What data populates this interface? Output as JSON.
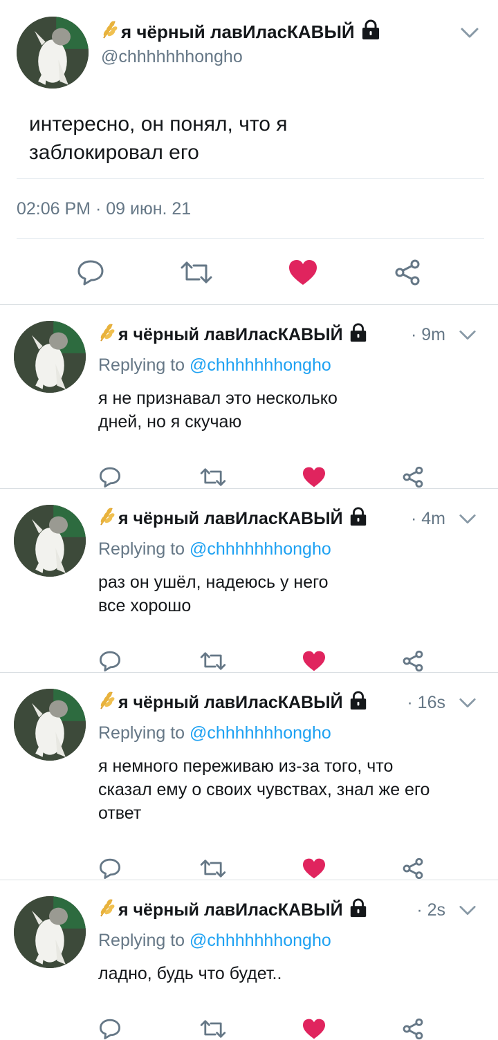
{
  "main_tweet": {
    "display_name": "я чёрный лавИласКАВЫЙ",
    "handle": "@chhhhhhhongho",
    "text": "интересно, он понял, что я\nзаблокировал его",
    "timestamp": "02:06 PM · 09 июн. 21",
    "icons": {
      "name_emoji": "wheat-emoji-icon",
      "protected": "lock-icon",
      "menu": "chevron-down-icon",
      "reply": "reply-icon",
      "retweet": "retweet-icon",
      "like": "heart-icon",
      "share": "share-icon"
    }
  },
  "replies": [
    {
      "display_name": "я чёрный лавИласКАВЫЙ",
      "time": "· 9m",
      "replying_prefix": "Replying to",
      "replying_to": "@chhhhhhhongho",
      "text": "я не признавал это несколько\nдней, но я скучаю"
    },
    {
      "display_name": "я чёрный лавИласКАВЫЙ",
      "time": "· 4m",
      "replying_prefix": "Replying to",
      "replying_to": "@chhhhhhhongho",
      "text": "раз он ушёл, надеюсь у него\nвсе хорошо"
    },
    {
      "display_name": "я чёрный лавИласКАВЫЙ",
      "time": "· 16s",
      "replying_prefix": "Replying to",
      "replying_to": "@chhhhhhhongho",
      "text": "я немного переживаю из-за того, что\nсказал ему о своих чувствах, знал же его\nответ"
    },
    {
      "display_name": "я чёрный лавИласКАВЫЙ",
      "time": "· 2s",
      "replying_prefix": "Replying to",
      "replying_to": "@chhhhhhhongho",
      "text": "ладно, будь что будет.."
    }
  ],
  "colors": {
    "like": "#e0245e",
    "mention": "#1da1f2",
    "muted": "#657786",
    "text": "#14171a",
    "wheat_emoji": "#e0a22a"
  }
}
